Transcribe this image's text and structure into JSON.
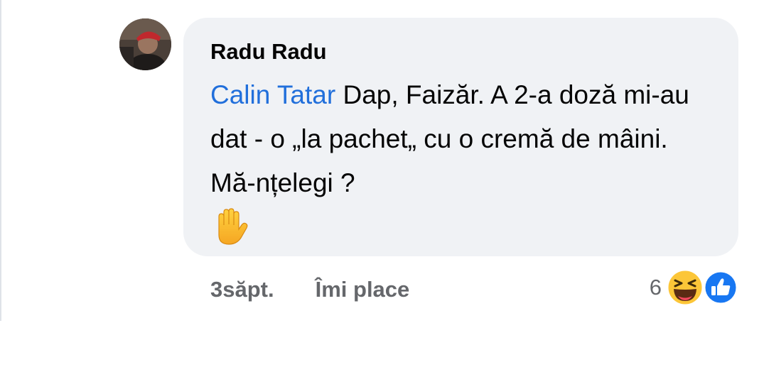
{
  "comment": {
    "author": "Radu Radu",
    "mention": "Calin Tatar",
    "text": " Dap, Faizăr. A 2-a doză mi-au dat - o „la pachet„ cu o cremă de mâini. Mă-nțelegi ?",
    "emoji": "raised-hand",
    "timestamp": "3săpt.",
    "like_label": "Îmi place",
    "reaction_count": "6",
    "reactions": [
      "haha",
      "like"
    ]
  },
  "colors": {
    "bubble": "#f0f2f5",
    "mention": "#216fdb",
    "meta": "#65676b",
    "like_blue": "#1877f2"
  }
}
